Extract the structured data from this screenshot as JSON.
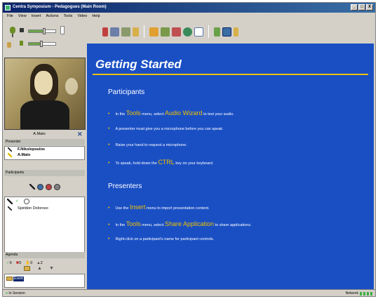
{
  "window": {
    "title": "Centra Symposium - Pedagogues (Main Room)",
    "controls": [
      "_",
      "□",
      "X"
    ]
  },
  "menu": [
    "File",
    "View",
    "Insert",
    "Actions",
    "Tools",
    "Video",
    "Help"
  ],
  "left_panel": {
    "speaker_name": "A.Mato",
    "presenter_section_label": "Presenter",
    "presenters": [
      "F.Nikolopoulos",
      "A.Mato"
    ],
    "participants_section_label": "Participants",
    "participants": [
      "Spiridon Doloroso"
    ],
    "counts": [
      {
        "icon": "check-icon",
        "value": "0"
      },
      {
        "icon": "x-icon",
        "value": "0"
      },
      {
        "icon": "hand-icon",
        "value": "0"
      },
      {
        "icon": "person-icon",
        "value": "2"
      }
    ],
    "agenda_label": "Agenda",
    "agenda_items": [
      "Event"
    ]
  },
  "content": {
    "title": "Getting Started",
    "participants_heading": "Participants",
    "participants_bullets": [
      {
        "pre": "In the ",
        "em1": "Tools",
        "mid": " menu, select ",
        "em2": "Audio Wizard",
        "post": " to test your audio."
      },
      {
        "pre": "A presenter must give you a microphone before you can speak.",
        "em1": "",
        "mid": "",
        "em2": "",
        "post": ""
      },
      {
        "pre": "Raise your hand to request a microphone.",
        "em1": "",
        "mid": "",
        "em2": "",
        "post": ""
      },
      {
        "pre": "To speak, hold down the ",
        "em1": "CTRL",
        "mid": " key on your keyboard.",
        "em2": "",
        "post": ""
      }
    ],
    "presenters_heading": "Presenters",
    "presenters_bullets": [
      {
        "pre": "Use the ",
        "em1": "Insert",
        "mid": " menu to import presentation content.",
        "em2": "",
        "post": ""
      },
      {
        "pre": "In the ",
        "em1": "Tools",
        "mid": " menu, select ",
        "em2": "Share Application",
        "post": " to share applications."
      },
      {
        "pre": "Right-click on a participant's name for participant controls.",
        "em1": "",
        "mid": "",
        "em2": "",
        "post": ""
      }
    ]
  },
  "status": {
    "left": "In Session",
    "right": "Network"
  },
  "colors": {
    "content_bg": "#1a4fc4",
    "accent": "#f0c000",
    "title_bar": "#0a246a"
  }
}
